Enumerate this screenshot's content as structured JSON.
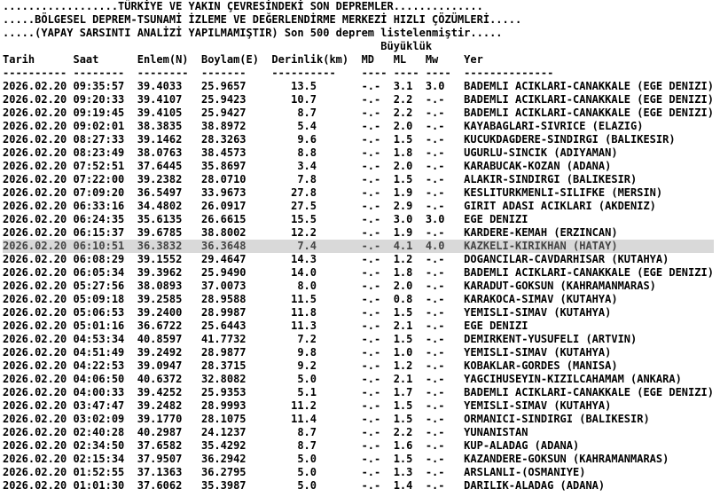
{
  "header": {
    "line1": "..................TÜRKİYE VE YAKIN ÇEVRESİNDEKİ SON DEPREMLER..............",
    "line2": ".....BÖLGESEL DEPREM-TSUNAMİ İZLEME VE DEĞERLENDİRME MERKEZİ HIZLI ÇÖZÜMLERİ.....",
    "line3": ".....(YAPAY SARSINTI ANALİZİ YAPILMAMIŞTIR) Son 500 deprem listelenmiştir.....",
    "magnitude_group": "Büyüklük",
    "columns": [
      "Tarih",
      "Saat",
      "Enlem(N)",
      "Boylam(E)",
      "Derinlik(km)",
      "MD",
      "ML",
      "Mw",
      "Yer"
    ],
    "dashes": [
      "----------",
      "--------",
      "--------",
      "-------",
      "----------",
      "----",
      "----",
      "----",
      "--------------"
    ]
  },
  "selected_index": 11,
  "rows": [
    {
      "date": "2026.02.20",
      "time": "09:35:57",
      "lat": "39.4033",
      "lon": "25.9657",
      "depth": "13.5",
      "md": "-.-",
      "ml": "3.1",
      "mw": "3.0",
      "place": "BADEMLI ACIKLARI-CANAKKALE (EGE DENIZI)"
    },
    {
      "date": "2026.02.20",
      "time": "09:20:33",
      "lat": "39.4107",
      "lon": "25.9423",
      "depth": "10.7",
      "md": "-.-",
      "ml": "2.2",
      "mw": "-.-",
      "place": "BADEMLI ACIKLARI-CANAKKALE (EGE DENIZI)"
    },
    {
      "date": "2026.02.20",
      "time": "09:19:45",
      "lat": "39.4105",
      "lon": "25.9427",
      "depth": "8.7",
      "md": "-.-",
      "ml": "2.2",
      "mw": "-.-",
      "place": "BADEMLI ACIKLARI-CANAKKALE (EGE DENIZI)"
    },
    {
      "date": "2026.02.20",
      "time": "09:02:01",
      "lat": "38.3835",
      "lon": "38.8972",
      "depth": "5.4",
      "md": "-.-",
      "ml": "2.0",
      "mw": "-.-",
      "place": "KAYABAGLARI-SIVRICE (ELAZIG)"
    },
    {
      "date": "2026.02.20",
      "time": "08:27:33",
      "lat": "39.1462",
      "lon": "28.3263",
      "depth": "9.6",
      "md": "-.-",
      "ml": "1.5",
      "mw": "-.-",
      "place": "KUCUKDAGDERE-SINDIRGI (BALIKESIR)"
    },
    {
      "date": "2026.02.20",
      "time": "08:23:49",
      "lat": "38.0763",
      "lat2": "",
      "lon": "38.4573",
      "depth": "8.8",
      "md": "-.-",
      "ml": "1.8",
      "mw": "-.-",
      "place": "UGURLU-SINCIK (ADIYAMAN)"
    },
    {
      "date": "2026.02.20",
      "time": "07:52:51",
      "lat": "37.6445",
      "lon": "35.8697",
      "depth": "3.4",
      "md": "-.-",
      "ml": "2.0",
      "mw": "-.-",
      "place": "KARABUCAK-KOZAN (ADANA)"
    },
    {
      "date": "2026.02.20",
      "time": "07:22:00",
      "lat": "39.2382",
      "lon": "28.0710",
      "depth": "7.8",
      "md": "-.-",
      "ml": "1.5",
      "mw": "-.-",
      "place": "ALAKIR-SINDIRGI (BALIKESIR)"
    },
    {
      "date": "2026.02.20",
      "time": "07:09:20",
      "lat": "36.5497",
      "lon": "33.9673",
      "depth": "27.8",
      "md": "-.-",
      "ml": "1.9",
      "mw": "-.-",
      "place": "KESLITURKMENLI-SILIFKE (MERSIN)"
    },
    {
      "date": "2026.02.20",
      "time": "06:33:16",
      "lat": "34.4802",
      "lon": "26.0917",
      "depth": "27.5",
      "md": "-.-",
      "ml": "2.9",
      "mw": "-.-",
      "place": "GIRIT ADASI ACIKLARI (AKDENIZ)"
    },
    {
      "date": "2026.02.20",
      "time": "06:24:35",
      "lat": "35.6135",
      "lon": "26.6615",
      "depth": "15.5",
      "md": "-.-",
      "ml": "3.0",
      "mw": "3.0",
      "place": "EGE DENIZI"
    },
    {
      "date": "2026.02.20",
      "time": "06:15:37",
      "lat": "39.6785",
      "lon": "38.8002",
      "depth": "12.2",
      "md": "-.-",
      "ml": "1.9",
      "mw": "-.-",
      "place": "KARDERE-KEMAH (ERZINCAN)"
    },
    {
      "date": "2026.02.20",
      "time": "06:10:51",
      "lat": "36.3832",
      "lon": "36.3648",
      "depth": "7.4",
      "md": "-.-",
      "ml": "4.1",
      "mw": "4.0",
      "place": "KAZKELI-KIRIKHAN (HATAY)"
    },
    {
      "date": "2026.02.20",
      "time": "06:08:29",
      "lat": "39.1552",
      "lon": "29.4647",
      "depth": "14.3",
      "md": "-.-",
      "ml": "1.2",
      "mw": "-.-",
      "place": "DOGANCILAR-CAVDARHISAR (KUTAHYA)"
    },
    {
      "date": "2026.02.20",
      "time": "06:05:34",
      "lat": "39.3962",
      "lon": "25.9490",
      "depth": "14.0",
      "md": "-.-",
      "ml": "1.8",
      "mw": "-.-",
      "place": "BADEMLI ACIKLARI-CANAKKALE (EGE DENIZI)"
    },
    {
      "date": "2026.02.20",
      "time": "05:27:56",
      "lat": "38.0893",
      "lon": "37.0073",
      "depth": "8.0",
      "md": "-.-",
      "ml": "2.0",
      "mw": "-.-",
      "place": "KARADUT-GOKSUN (KAHRAMANMARAS)"
    },
    {
      "date": "2026.02.20",
      "time": "05:09:18",
      "lat": "39.2585",
      "lon": "28.9588",
      "depth": "11.5",
      "md": "-.-",
      "ml": "0.8",
      "mw": "-.-",
      "place": "KARAKOCA-SIMAV (KUTAHYA)"
    },
    {
      "date": "2026.02.20",
      "time": "05:06:53",
      "lat": "39.2400",
      "lon": "28.9987",
      "depth": "11.8",
      "md": "-.-",
      "ml": "1.5",
      "mw": "-.-",
      "place": "YEMISLI-SIMAV (KUTAHYA)"
    },
    {
      "date": "2026.02.20",
      "time": "05:01:16",
      "lat": "36.6722",
      "lon": "25.6443",
      "depth": "11.3",
      "md": "-.-",
      "ml": "2.1",
      "mw": "-.-",
      "place": "EGE DENIZI"
    },
    {
      "date": "2026.02.20",
      "time": "04:53:34",
      "lat": "40.8597",
      "lon": "41.7732",
      "depth": "7.2",
      "md": "-.-",
      "ml": "1.5",
      "mw": "-.-",
      "place": "DEMIRKENT-YUSUFELI (ARTVIN)"
    },
    {
      "date": "2026.02.20",
      "time": "04:51:49",
      "lat": "39.2492",
      "lon": "28.9877",
      "depth": "9.8",
      "md": "-.-",
      "ml": "1.0",
      "mw": "-.-",
      "place": "YEMISLI-SIMAV (KUTAHYA)"
    },
    {
      "date": "2026.02.20",
      "time": "04:22:53",
      "lat": "39.0947",
      "lon": "28.3715",
      "depth": "9.2",
      "md": "-.-",
      "ml": "1.2",
      "mw": "-.-",
      "place": "KOBAKLAR-GORDES (MANISA)"
    },
    {
      "date": "2026.02.20",
      "time": "04:06:50",
      "lat": "40.6372",
      "lon": "32.8082",
      "depth": "5.0",
      "md": "-.-",
      "ml": "2.1",
      "mw": "-.-",
      "place": "YAGCIHUSEYIN-KIZILCAHAMAM (ANKARA)"
    },
    {
      "date": "2026.02.20",
      "time": "04:00:33",
      "lat": "39.4252",
      "lon": "25.9353",
      "depth": "5.1",
      "md": "-.-",
      "ml": "1.7",
      "mw": "-.-",
      "place": "BADEMLI ACIKLARI-CANAKKALE (EGE DENIZI)"
    },
    {
      "date": "2026.02.20",
      "time": "03:47:47",
      "lat": "39.2482",
      "lon": "28.9993",
      "depth": "11.2",
      "md": "-.-",
      "ml": "1.5",
      "mw": "-.-",
      "place": "YEMISLI-SIMAV (KUTAHYA)"
    },
    {
      "date": "2026.02.20",
      "time": "03:02:09",
      "lat": "39.1770",
      "lon": "28.1075",
      "depth": "11.4",
      "md": "-.-",
      "ml": "1.5",
      "mw": "-.-",
      "place": "ORMANICI-SINDIRGI (BALIKESIR)"
    },
    {
      "date": "2026.02.20",
      "time": "02:40:28",
      "lat": "40.2987",
      "lon": "24.1237",
      "depth": "8.7",
      "md": "-.-",
      "ml": "2.2",
      "mw": "-.-",
      "place": "YUNANISTAN"
    },
    {
      "date": "2026.02.20",
      "time": "02:34:50",
      "lat": "37.6582",
      "lon": "35.4292",
      "depth": "8.7",
      "md": "-.-",
      "ml": "1.6",
      "mw": "-.-",
      "place": "KUP-ALADAG (ADANA)"
    },
    {
      "date": "2026.02.20",
      "time": "02:15:34",
      "lat": "37.9507",
      "lon": "36.2942",
      "depth": "5.0",
      "md": "-.-",
      "ml": "1.5",
      "mw": "-.-",
      "place": "KAZANDERE-GOKSUN (KAHRAMANMARAS)"
    },
    {
      "date": "2026.02.20",
      "time": "01:52:55",
      "lat": "37.1363",
      "lon": "36.2795",
      "depth": "5.0",
      "md": "-.-",
      "ml": "1.3",
      "mw": "-.-",
      "place": "ARSLANLI-(OSMANIYE)"
    },
    {
      "date": "2026.02.20",
      "time": "01:01:30",
      "lat": "37.6062",
      "lon": "35.3987",
      "depth": "5.0",
      "md": "-.-",
      "ml": "1.4",
      "mw": "-.-",
      "place": "DARILIK-ALADAG (ADANA)"
    }
  ]
}
